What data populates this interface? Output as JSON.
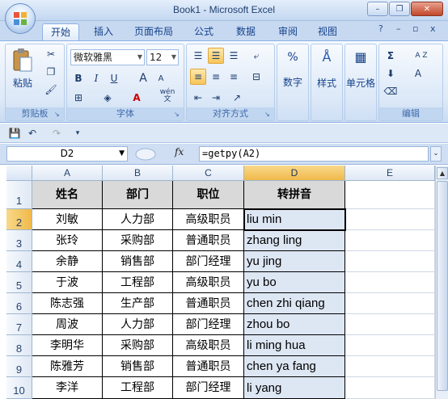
{
  "window": {
    "title": "Book1 - Microsoft Excel",
    "minimize": "–",
    "restore": "❐",
    "close": "✕"
  },
  "ribbon_tabs": [
    "开始",
    "插入",
    "页面布局",
    "公式",
    "数据",
    "审阅",
    "视图"
  ],
  "ribbon_tabs_active": "开始",
  "ribbon_right": {
    "help": "?",
    "min": "–",
    "restore": "▫",
    "close": "x"
  },
  "ribbon": {
    "clipboard": {
      "label": "剪贴板",
      "paste": "粘贴"
    },
    "font": {
      "label": "字体",
      "name": "微软雅黑",
      "size": "12",
      "bold": "B",
      "italic": "I",
      "underline": "U",
      "grow": "A",
      "shrink": "A",
      "wen": "wén",
      "wen_char": "文"
    },
    "align": {
      "label": "对齐方式"
    },
    "number": {
      "label": "数字",
      "pct": "%"
    },
    "style": {
      "label": "样式"
    },
    "cells": {
      "label": "单元格"
    },
    "edit": {
      "label": "编辑",
      "sigma": "Σ",
      "sort": "A Z",
      "find": "A"
    }
  },
  "formula_bar": {
    "name_box": "D2",
    "fx": "fx",
    "formula": "=getpy(A2)"
  },
  "columns": [
    "A",
    "B",
    "C",
    "D",
    "E"
  ],
  "rows": [
    "1",
    "2",
    "3",
    "4",
    "5",
    "6",
    "7",
    "8",
    "9",
    "10"
  ],
  "table": {
    "headers": [
      "姓名",
      "部门",
      "职位",
      "转拼音"
    ],
    "data": [
      [
        "刘敏",
        "人力部",
        "高级职员",
        "liu min"
      ],
      [
        "张玲",
        "采购部",
        "普通职员",
        "zhang ling"
      ],
      [
        "余静",
        "销售部",
        "部门经理",
        "yu jing"
      ],
      [
        "于波",
        "工程部",
        "高级职员",
        "yu bo"
      ],
      [
        "陈志强",
        "生产部",
        "普通职员",
        "chen zhi qiang"
      ],
      [
        "周波",
        "人力部",
        "部门经理",
        "zhou bo"
      ],
      [
        "李明华",
        "采购部",
        "高级职员",
        "li ming hua"
      ],
      [
        "陈雅芳",
        "销售部",
        "普通职员",
        "chen ya fang"
      ],
      [
        "李洋",
        "工程部",
        "部门经理",
        "li yang"
      ]
    ]
  },
  "active_cell": "D2",
  "colors": {
    "accent": "#15428b",
    "ribbon_bg": "#dfeaf8",
    "selection": "#f0b94a",
    "blue_fill": "#dde6f3",
    "header_fill": "#d9d9d9"
  }
}
